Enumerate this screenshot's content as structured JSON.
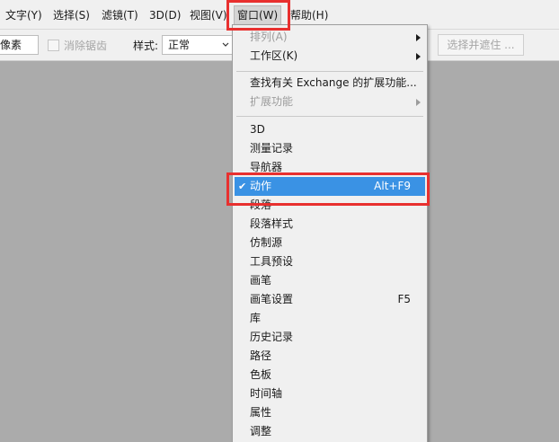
{
  "menubar": {
    "items": [
      {
        "label": "文字(Y)"
      },
      {
        "label": "选择(S)"
      },
      {
        "label": "滤镜(T)"
      },
      {
        "label": "3D(D)"
      },
      {
        "label": "视图(V)"
      },
      {
        "label": "窗口(W)"
      },
      {
        "label": "帮助(H)"
      }
    ]
  },
  "options": {
    "feather_value": "像素",
    "antialias_label": "消除锯齿",
    "style_label": "样式:",
    "style_value": "正常",
    "select_mask_button": "选择并遮住 ..."
  },
  "window_menu": {
    "items": [
      {
        "label": "排列(A)",
        "disabled": true,
        "submenu": true
      },
      {
        "label": "工作区(K)",
        "submenu": true
      },
      {
        "label": "查找有关 Exchange 的扩展功能..."
      },
      {
        "label": "扩展功能",
        "disabled": true,
        "submenu": true
      },
      {
        "label": "3D"
      },
      {
        "label": "测量记录"
      },
      {
        "label": "导航器"
      },
      {
        "label": "动作",
        "shortcut": "Alt+F9",
        "checked": true,
        "highlighted": true
      },
      {
        "label": "段落"
      },
      {
        "label": "段落样式"
      },
      {
        "label": "仿制源"
      },
      {
        "label": "工具预设"
      },
      {
        "label": "画笔"
      },
      {
        "label": "画笔设置",
        "shortcut": "F5"
      },
      {
        "label": "库"
      },
      {
        "label": "历史记录"
      },
      {
        "label": "路径"
      },
      {
        "label": "色板"
      },
      {
        "label": "时间轴"
      },
      {
        "label": "属性"
      },
      {
        "label": "调整"
      }
    ]
  },
  "colors": {
    "highlight": "#3a92e4",
    "annotation_red": "#e8302f"
  }
}
